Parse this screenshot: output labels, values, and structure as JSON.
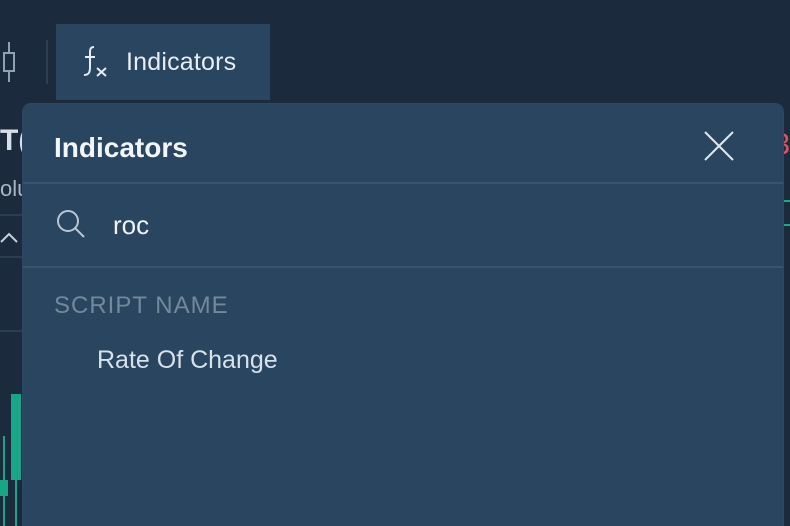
{
  "toolbar": {
    "indicators_tab_label": "Indicators"
  },
  "background": {
    "left_title_fragment": "T(",
    "left_subtitle_fragment": "olu",
    "right_red_fragment": "3"
  },
  "modal": {
    "title": "Indicators",
    "search": {
      "value": "roc",
      "placeholder": ""
    },
    "section_label": "SCRIPT NAME",
    "results": [
      {
        "label": "Rate Of Change"
      }
    ]
  },
  "colors": {
    "page_bg": "#1b2b3d",
    "modal_bg": "#294560",
    "tab_bg": "#2a4560",
    "candle_green": "#18a686",
    "accent_red": "#e0515f"
  },
  "icons": {
    "candle": "candlestick-icon",
    "fx": "function-icon",
    "close": "close-icon",
    "search": "search-icon",
    "chevron": "chevron-up-icon"
  }
}
